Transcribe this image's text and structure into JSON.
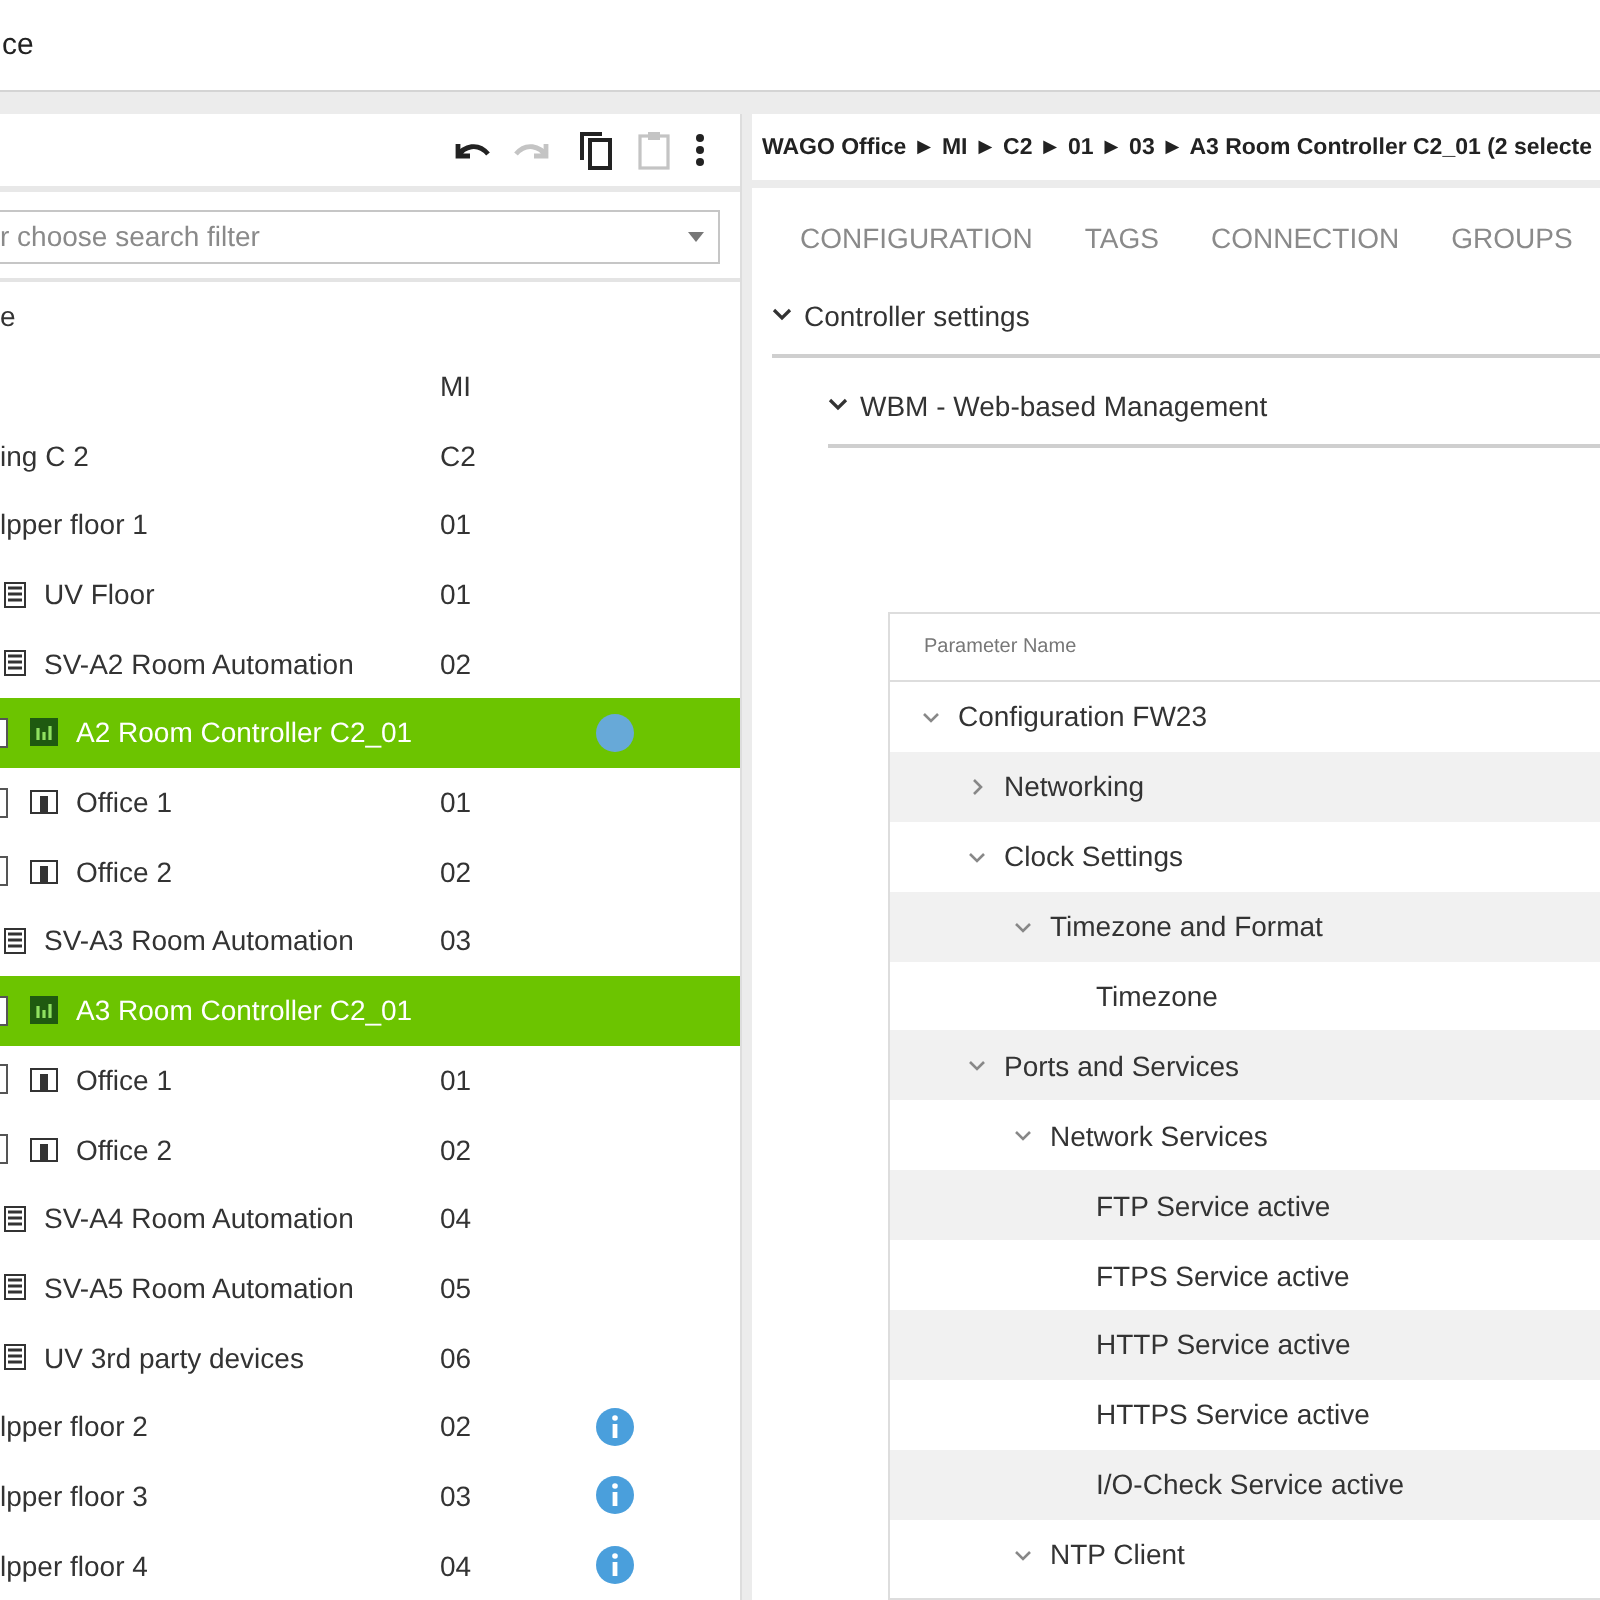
{
  "window": {
    "title": "ce"
  },
  "toolbar": [
    {
      "kind": "undo",
      "disabled": false
    },
    {
      "kind": "redo",
      "disabled": true
    },
    {
      "kind": "copy",
      "disabled": false
    },
    {
      "kind": "paste",
      "disabled": true
    },
    {
      "kind": "more",
      "disabled": false
    }
  ],
  "search": {
    "placeholder": "r choose search filter"
  },
  "tree": [
    {
      "label": "e",
      "selected": false,
      "info": false,
      "children": [
        {
          "code": "MI",
          "selected": false,
          "info": false,
          "children": [
            {
              "label": "ing C 2",
              "code": "C2",
              "selected": false,
              "info": false,
              "children": [
                {
                  "label": "lpper floor 1",
                  "code": "01",
                  "selected": false,
                  "info": false,
                  "children": [
                    {
                      "label": "UV Floor",
                      "code": "01",
                      "kind": "building",
                      "selected": false,
                      "info": false
                    },
                    {
                      "label": "SV-A2 Room Automation",
                      "code": "02",
                      "kind": "building",
                      "selected": false,
                      "info": false,
                      "children": [
                        {
                          "label": "A2 Room Controller C2_01",
                          "kind": "controller",
                          "selected": true,
                          "info": true
                        },
                        {
                          "label": "Office 1",
                          "code": "01",
                          "kind": "room",
                          "selected": false,
                          "info": false
                        },
                        {
                          "label": "Office 2",
                          "code": "02",
                          "kind": "room",
                          "selected": false,
                          "info": false
                        }
                      ]
                    },
                    {
                      "label": "SV-A3 Room Automation",
                      "code": "03",
                      "kind": "building",
                      "selected": false,
                      "info": false,
                      "children": [
                        {
                          "label": "A3 Room Controller C2_01",
                          "kind": "controller",
                          "selected": true,
                          "info": false
                        },
                        {
                          "label": "Office 1",
                          "code": "01",
                          "kind": "room",
                          "selected": false,
                          "info": false
                        },
                        {
                          "label": "Office 2",
                          "code": "02",
                          "kind": "room",
                          "selected": false,
                          "info": false
                        }
                      ]
                    },
                    {
                      "label": "SV-A4 Room Automation",
                      "code": "04",
                      "kind": "building",
                      "selected": false,
                      "info": false
                    },
                    {
                      "label": "SV-A5 Room Automation",
                      "code": "05",
                      "kind": "building",
                      "selected": false,
                      "info": false
                    },
                    {
                      "label": "UV 3rd party devices",
                      "code": "06",
                      "kind": "building",
                      "selected": false,
                      "info": false
                    }
                  ]
                },
                {
                  "label": "lpper floor 2",
                  "code": "02",
                  "selected": false,
                  "info": true
                },
                {
                  "label": "lpper floor 3",
                  "code": "03",
                  "selected": false,
                  "info": true
                },
                {
                  "label": "lpper floor 4",
                  "code": "04",
                  "selected": false,
                  "info": true
                }
              ]
            }
          ]
        }
      ]
    }
  ],
  "breadcrumb": "WAGO Office ► MI ► C2 ► 01 ► 03 ► A3 Room Controller C2_01 (2 selecte",
  "tabs": [
    "CONFIGURATION",
    "TAGS",
    "CONNECTION",
    "GROUPS"
  ],
  "sections": [
    {
      "label": "Controller settings",
      "expanded": true,
      "children": [
        {
          "label": "WBM - Web-based Management",
          "expanded": true
        }
      ]
    }
  ],
  "parameters": {
    "column": "Parameter Name",
    "rows": [
      {
        "label": "Configuration FW23",
        "expanded": true,
        "children": [
          {
            "label": "Networking",
            "expanded": false
          },
          {
            "label": "Clock Settings",
            "expanded": true,
            "children": [
              {
                "label": "Timezone and Format",
                "expanded": true,
                "children": [
                  {
                    "label": "Timezone"
                  }
                ]
              }
            ]
          },
          {
            "label": "Ports and Services",
            "expanded": true,
            "children": [
              {
                "label": "Network Services",
                "expanded": true,
                "children": [
                  {
                    "label": "FTP Service active"
                  },
                  {
                    "label": "FTPS Service active"
                  },
                  {
                    "label": "HTTP Service active"
                  },
                  {
                    "label": "HTTPS Service active"
                  },
                  {
                    "label": "I/O-Check Service active"
                  }
                ]
              },
              {
                "label": "NTP Client",
                "expanded": true
              }
            ]
          }
        ]
      }
    ]
  }
}
